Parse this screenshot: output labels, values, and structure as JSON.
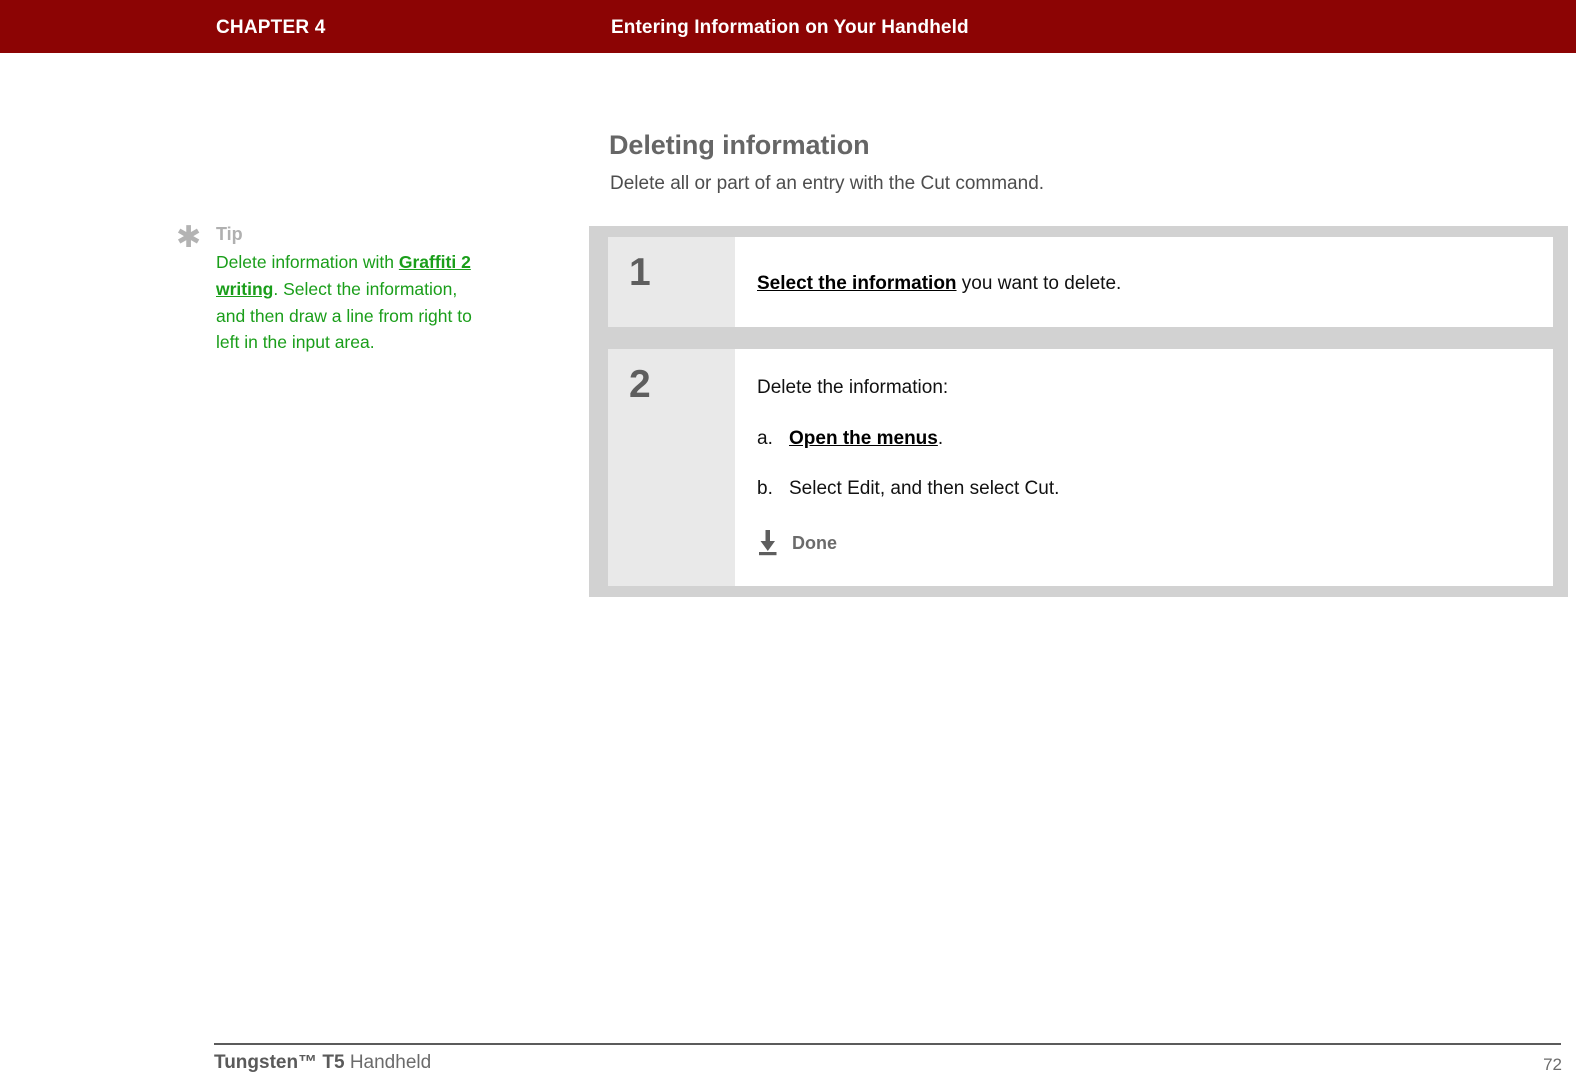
{
  "header": {
    "chapter_label": "CHAPTER 4",
    "title": "Entering Information on Your Handheld",
    "background_color": "#8c0404",
    "text_color": "#ffffff"
  },
  "section": {
    "heading": "Deleting information",
    "intro": "Delete all or part of an entry with the Cut command."
  },
  "tip": {
    "icon": "asterisk-icon",
    "glyph": "✱",
    "heading": "Tip",
    "text_before_link": "Delete information with ",
    "link_text": "Graffiti 2 writing",
    "text_after_link": ". Select the information, and then draw a line from right to left in the input area.",
    "color": "#1a9e1a"
  },
  "steps": [
    {
      "number": "1",
      "link_text": "Select the information",
      "rest_text": " you want to delete."
    },
    {
      "number": "2",
      "intro": "Delete the information:",
      "substeps": [
        {
          "marker": "a.",
          "link_text": "Open the menus",
          "rest_text": "."
        },
        {
          "marker": "b.",
          "link_text": "",
          "rest_text": "Select Edit, and then select Cut."
        }
      ],
      "done": {
        "icon": "download-arrow-icon",
        "label": "Done"
      }
    }
  ],
  "footer": {
    "product_bold": "Tungsten™ T5",
    "product_rest": " Handheld",
    "page_number": "72"
  }
}
